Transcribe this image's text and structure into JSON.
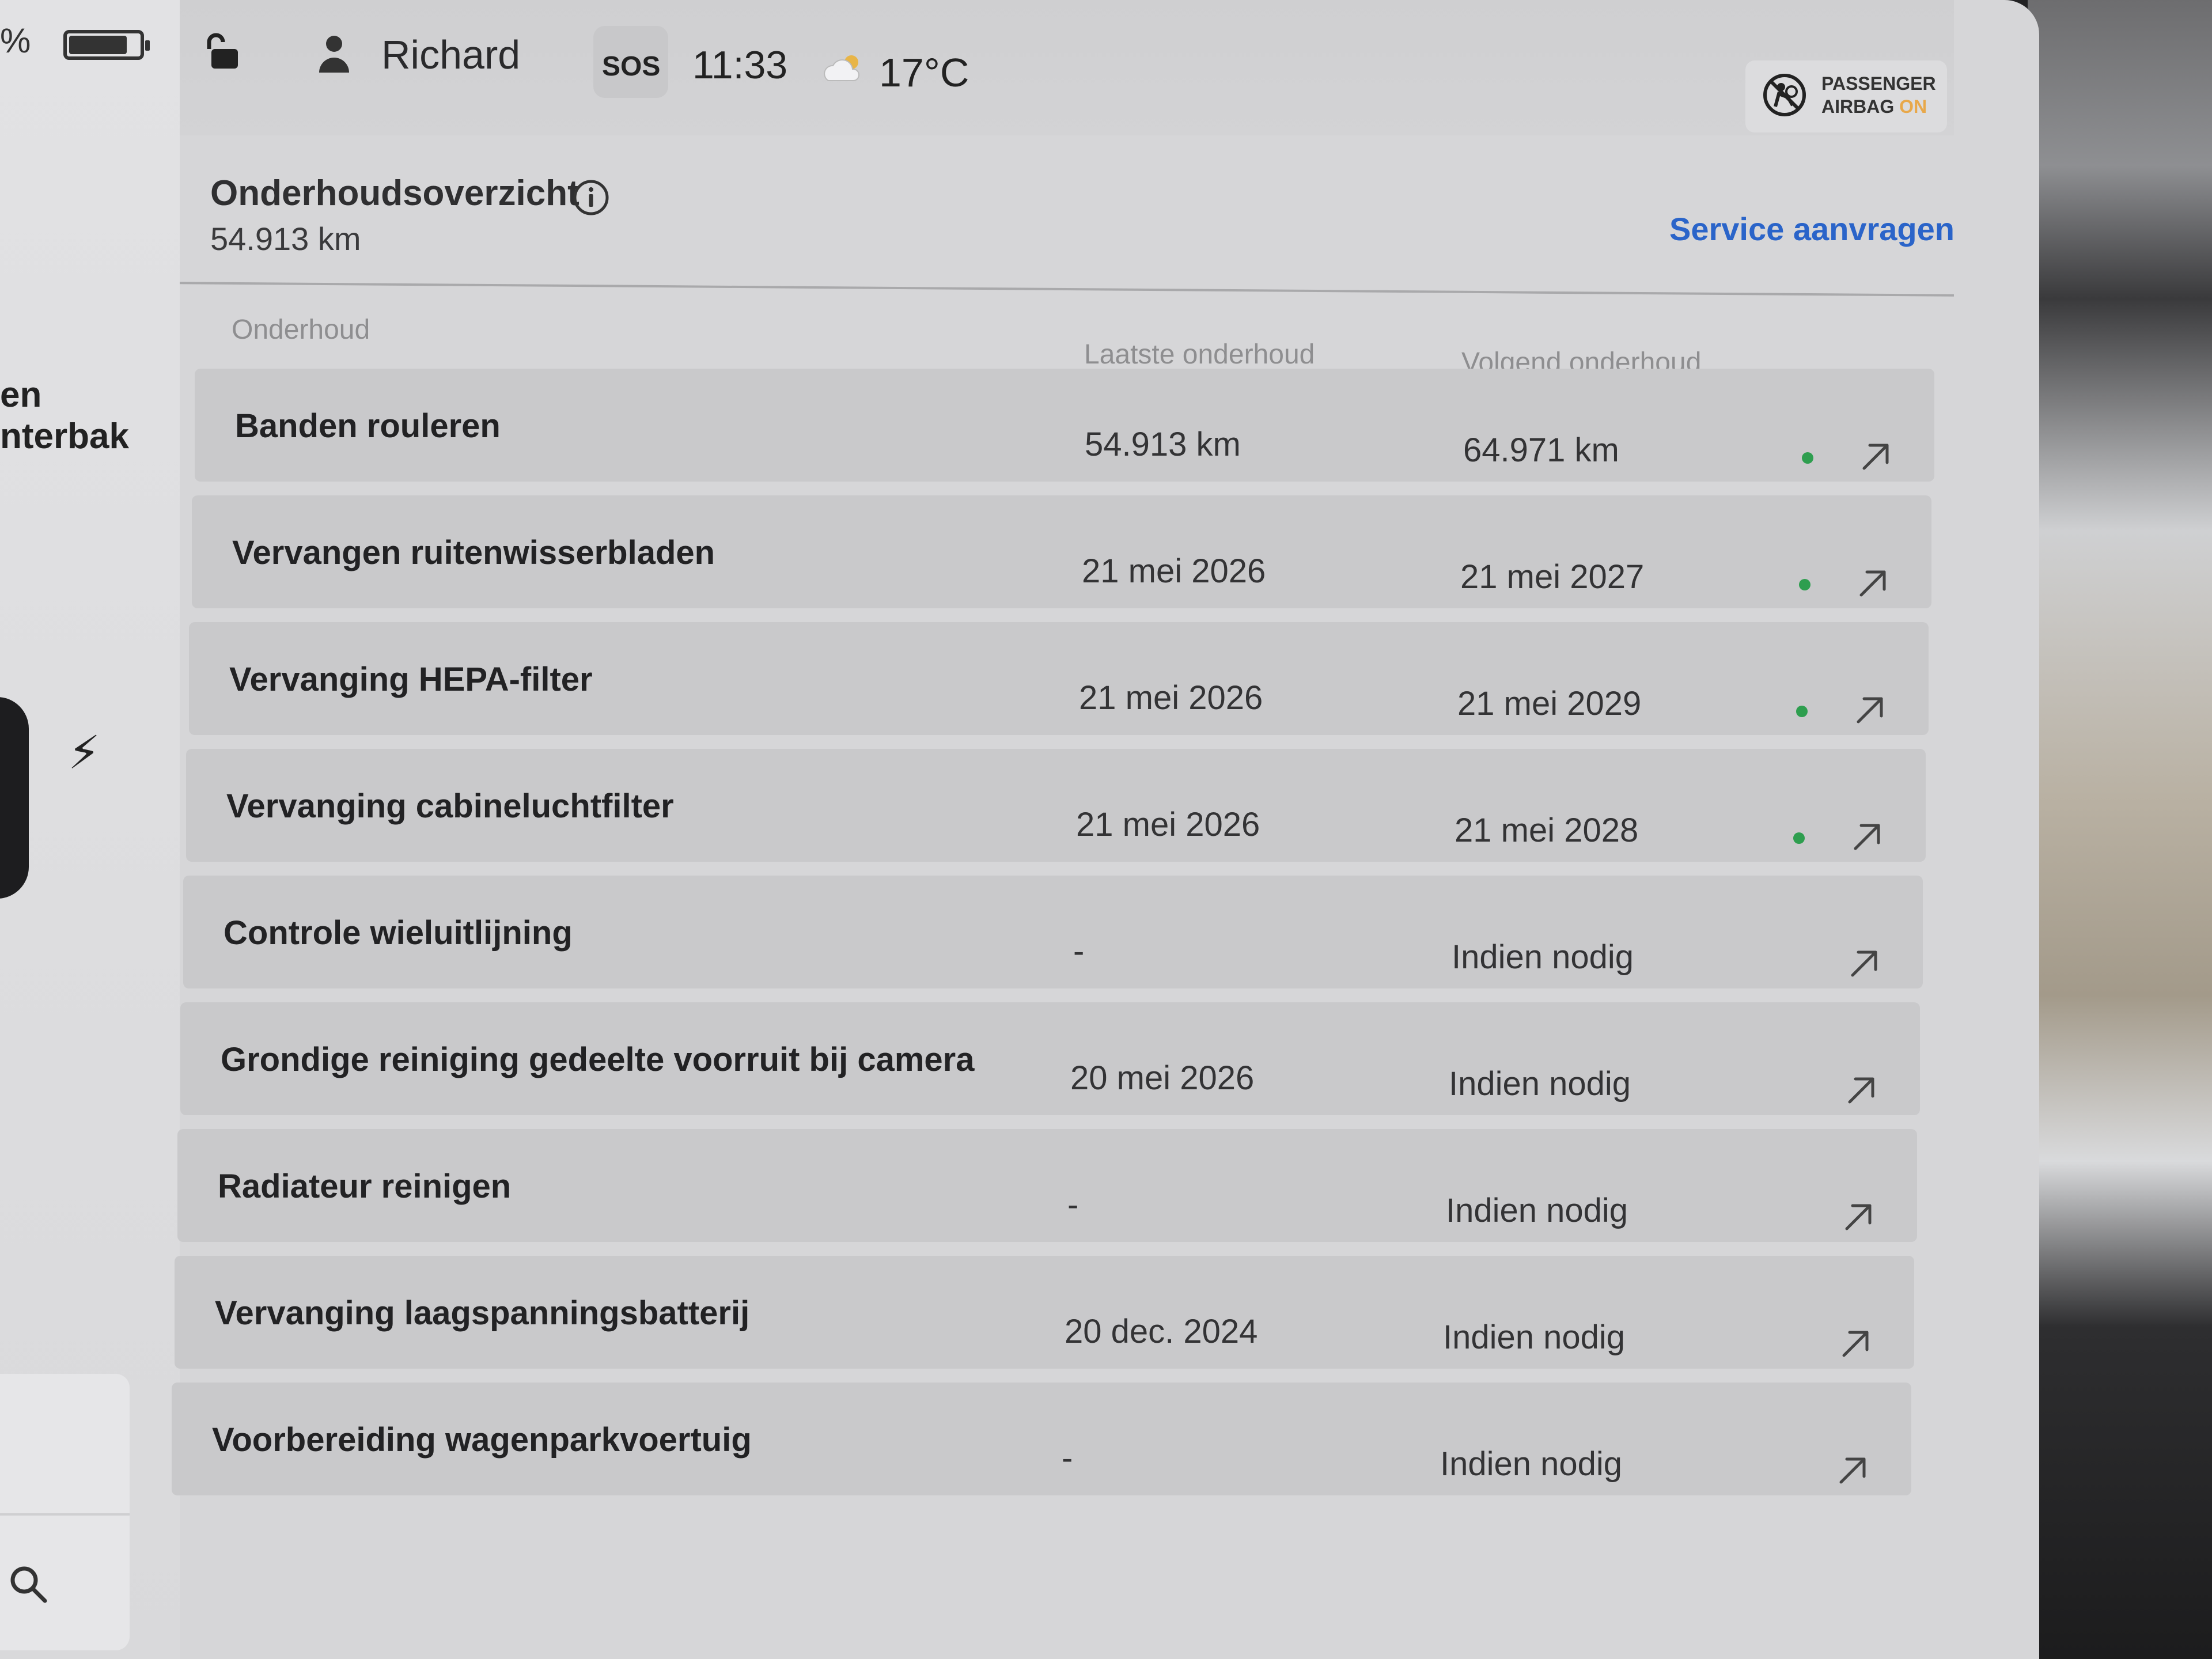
{
  "status": {
    "battery_percent": "%",
    "user": "Richard",
    "sos": "SOS",
    "time": "11:33",
    "temperature": "17°C",
    "airbag_line1": "PASSENGER",
    "airbag_line2": "AIRBAG",
    "airbag_state": "ON"
  },
  "left": {
    "label1": "en",
    "label2": "nterbak",
    "bolt": "⚡"
  },
  "header": {
    "title": "Onderhoudsoverzicht",
    "odometer": "54.913  km",
    "service_link": "Service aanvragen"
  },
  "columns": {
    "maintenance": "Onderhoud",
    "last": "Laatste onderhoud",
    "next": "Volgend onderhoud"
  },
  "colors": {
    "status_ok": "#2e9e4f",
    "link": "#2a64c9"
  },
  "rows": [
    {
      "name": "Banden rouleren",
      "last": "54.913 km",
      "next": "64.971 km",
      "status": "ok"
    },
    {
      "name": "Vervangen ruitenwisserbladen",
      "last": "21 mei 2026",
      "next": "21 mei 2027",
      "status": "ok"
    },
    {
      "name": "Vervanging HEPA-filter",
      "last": "21 mei 2026",
      "next": "21 mei 2029",
      "status": "ok"
    },
    {
      "name": "Vervanging cabineluchtfilter",
      "last": "21 mei 2026",
      "next": "21 mei 2028",
      "status": "ok"
    },
    {
      "name": "Controle wieluitlijning",
      "last": "-",
      "next": "Indien nodig",
      "status": "none"
    },
    {
      "name": "Grondige reiniging gedeelte voorruit bij camera",
      "last": "20 mei 2026",
      "next": "Indien nodig",
      "status": "none"
    },
    {
      "name": "Radiateur reinigen",
      "last": "-",
      "next": "Indien nodig",
      "status": "none"
    },
    {
      "name": "Vervanging laagspanningsbatterij",
      "last": "20 dec. 2024",
      "next": "Indien nodig",
      "status": "none"
    },
    {
      "name": "Voorbereiding wagenparkvoertuig",
      "last": "-",
      "next": "Indien nodig",
      "status": "none"
    }
  ]
}
